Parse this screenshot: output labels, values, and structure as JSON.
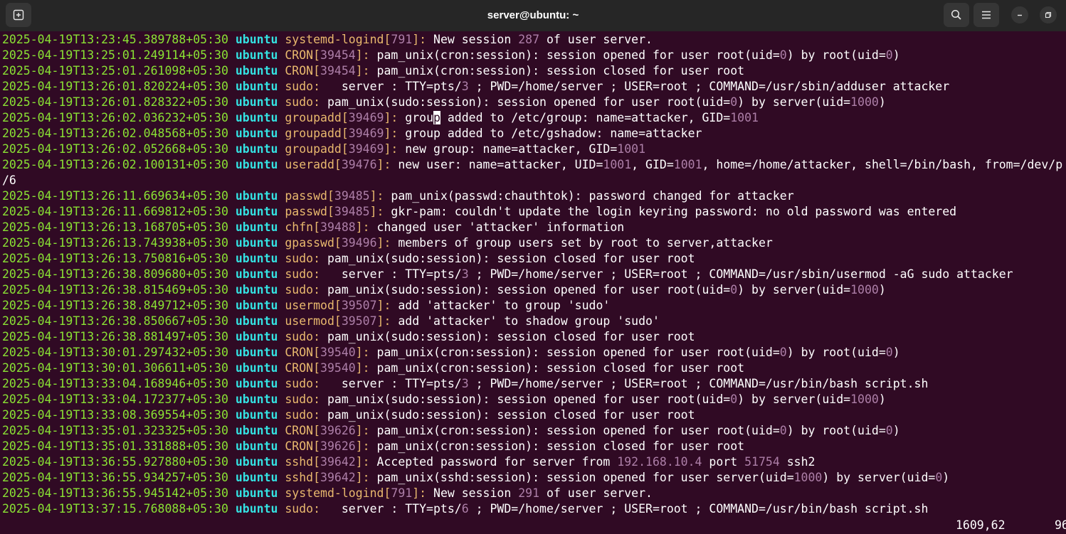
{
  "window": {
    "title": "server@ubuntu: ~",
    "new_tab_icon": "new-tab-icon",
    "search_icon": "search-icon",
    "menu_icon": "hamburger-menu-icon",
    "minimize_icon": "minimize-icon",
    "restore_icon": "restore-icon"
  },
  "colors": {
    "background": "#300a24",
    "timestamp": "#8ae234",
    "host": "#34e2e2",
    "process": "#e9b96e",
    "number": "#ad7fa8",
    "text": "#ffffff"
  },
  "log_lines": [
    {
      "ts": "2025-04-19T13:23:45.389788+05:30",
      "host": "ubuntu",
      "parts": [
        [
          "p",
          "systemd-logind["
        ],
        [
          "n",
          "791"
        ],
        [
          "p",
          "]:"
        ],
        [
          "t",
          " New session "
        ],
        [
          "n",
          "287"
        ],
        [
          "t",
          " of user server."
        ]
      ]
    },
    {
      "ts": "2025-04-19T13:25:01.249114+05:30",
      "host": "ubuntu",
      "parts": [
        [
          "p",
          "CRON["
        ],
        [
          "n",
          "39454"
        ],
        [
          "p",
          "]:"
        ],
        [
          "t",
          " pam_unix(cron:session): session opened for user root(uid="
        ],
        [
          "n",
          "0"
        ],
        [
          "t",
          ") by root(uid="
        ],
        [
          "n",
          "0"
        ],
        [
          "t",
          ")"
        ]
      ]
    },
    {
      "ts": "2025-04-19T13:25:01.261098+05:30",
      "host": "ubuntu",
      "parts": [
        [
          "p",
          "CRON["
        ],
        [
          "n",
          "39454"
        ],
        [
          "p",
          "]:"
        ],
        [
          "t",
          " pam_unix(cron:session): session closed for user root"
        ]
      ]
    },
    {
      "ts": "2025-04-19T13:26:01.820224+05:30",
      "host": "ubuntu",
      "parts": [
        [
          "p",
          "sudo:"
        ],
        [
          "t",
          "   server : TTY=pts/"
        ],
        [
          "n",
          "3"
        ],
        [
          "t",
          " ; PWD=/home/server ; USER=root ; COMMAND=/usr/sbin/adduser attacker"
        ]
      ]
    },
    {
      "ts": "2025-04-19T13:26:01.828322+05:30",
      "host": "ubuntu",
      "parts": [
        [
          "p",
          "sudo:"
        ],
        [
          "t",
          " pam_unix(sudo:session): session opened for user root(uid="
        ],
        [
          "n",
          "0"
        ],
        [
          "t",
          ") by server(uid="
        ],
        [
          "n",
          "1000"
        ],
        [
          "t",
          ")"
        ]
      ]
    },
    {
      "ts": "2025-04-19T13:26:02.036232+05:30",
      "host": "ubuntu",
      "parts": [
        [
          "p",
          "groupadd["
        ],
        [
          "n",
          "39469"
        ],
        [
          "p",
          "]:"
        ],
        [
          "t",
          " grou"
        ],
        [
          "c",
          "p"
        ],
        [
          "t",
          " added to /etc/group: name=attacker, GID="
        ],
        [
          "n",
          "1001"
        ]
      ]
    },
    {
      "ts": "2025-04-19T13:26:02.048568+05:30",
      "host": "ubuntu",
      "parts": [
        [
          "p",
          "groupadd["
        ],
        [
          "n",
          "39469"
        ],
        [
          "p",
          "]:"
        ],
        [
          "t",
          " group added to /etc/gshadow: name=attacker"
        ]
      ]
    },
    {
      "ts": "2025-04-19T13:26:02.052668+05:30",
      "host": "ubuntu",
      "parts": [
        [
          "p",
          "groupadd["
        ],
        [
          "n",
          "39469"
        ],
        [
          "p",
          "]:"
        ],
        [
          "t",
          " new group: name=attacker, GID="
        ],
        [
          "n",
          "1001"
        ]
      ]
    },
    {
      "ts": "2025-04-19T13:26:02.100131+05:30",
      "host": "ubuntu",
      "parts": [
        [
          "p",
          "useradd["
        ],
        [
          "n",
          "39476"
        ],
        [
          "p",
          "]:"
        ],
        [
          "t",
          " new user: name=attacker, UID="
        ],
        [
          "n",
          "1001"
        ],
        [
          "t",
          ", GID="
        ],
        [
          "n",
          "1001"
        ],
        [
          "t",
          ", home=/home/attacker, shell=/bin/bash, from=/dev/p"
        ]
      ]
    },
    {
      "ts": "",
      "host": "",
      "parts": [
        [
          "t",
          "/6"
        ]
      ]
    },
    {
      "ts": "2025-04-19T13:26:11.669634+05:30",
      "host": "ubuntu",
      "parts": [
        [
          "p",
          "passwd["
        ],
        [
          "n",
          "39485"
        ],
        [
          "p",
          "]:"
        ],
        [
          "t",
          " pam_unix(passwd:chauthtok): password changed for attacker"
        ]
      ]
    },
    {
      "ts": "2025-04-19T13:26:11.669812+05:30",
      "host": "ubuntu",
      "parts": [
        [
          "p",
          "passwd["
        ],
        [
          "n",
          "39485"
        ],
        [
          "p",
          "]:"
        ],
        [
          "t",
          " gkr-pam: couldn't update the login keyring password: no old password was entered"
        ]
      ]
    },
    {
      "ts": "2025-04-19T13:26:13.168705+05:30",
      "host": "ubuntu",
      "parts": [
        [
          "p",
          "chfn["
        ],
        [
          "n",
          "39488"
        ],
        [
          "p",
          "]:"
        ],
        [
          "t",
          " changed user 'attacker' information"
        ]
      ]
    },
    {
      "ts": "2025-04-19T13:26:13.743938+05:30",
      "host": "ubuntu",
      "parts": [
        [
          "p",
          "gpasswd["
        ],
        [
          "n",
          "39496"
        ],
        [
          "p",
          "]:"
        ],
        [
          "t",
          " members of group users set by root to server,attacker"
        ]
      ]
    },
    {
      "ts": "2025-04-19T13:26:13.750816+05:30",
      "host": "ubuntu",
      "parts": [
        [
          "p",
          "sudo:"
        ],
        [
          "t",
          " pam_unix(sudo:session): session closed for user root"
        ]
      ]
    },
    {
      "ts": "2025-04-19T13:26:38.809680+05:30",
      "host": "ubuntu",
      "parts": [
        [
          "p",
          "sudo:"
        ],
        [
          "t",
          "   server : TTY=pts/"
        ],
        [
          "n",
          "3"
        ],
        [
          "t",
          " ; PWD=/home/server ; USER=root ; COMMAND=/usr/sbin/usermod -aG sudo attacker"
        ]
      ]
    },
    {
      "ts": "2025-04-19T13:26:38.815469+05:30",
      "host": "ubuntu",
      "parts": [
        [
          "p",
          "sudo:"
        ],
        [
          "t",
          " pam_unix(sudo:session): session opened for user root(uid="
        ],
        [
          "n",
          "0"
        ],
        [
          "t",
          ") by server(uid="
        ],
        [
          "n",
          "1000"
        ],
        [
          "t",
          ")"
        ]
      ]
    },
    {
      "ts": "2025-04-19T13:26:38.849712+05:30",
      "host": "ubuntu",
      "parts": [
        [
          "p",
          "usermod["
        ],
        [
          "n",
          "39507"
        ],
        [
          "p",
          "]:"
        ],
        [
          "t",
          " add 'attacker' to group 'sudo'"
        ]
      ]
    },
    {
      "ts": "2025-04-19T13:26:38.850667+05:30",
      "host": "ubuntu",
      "parts": [
        [
          "p",
          "usermod["
        ],
        [
          "n",
          "39507"
        ],
        [
          "p",
          "]:"
        ],
        [
          "t",
          " add 'attacker' to shadow group 'sudo'"
        ]
      ]
    },
    {
      "ts": "2025-04-19T13:26:38.881497+05:30",
      "host": "ubuntu",
      "parts": [
        [
          "p",
          "sudo:"
        ],
        [
          "t",
          " pam_unix(sudo:session): session closed for user root"
        ]
      ]
    },
    {
      "ts": "2025-04-19T13:30:01.297432+05:30",
      "host": "ubuntu",
      "parts": [
        [
          "p",
          "CRON["
        ],
        [
          "n",
          "39540"
        ],
        [
          "p",
          "]:"
        ],
        [
          "t",
          " pam_unix(cron:session): session opened for user root(uid="
        ],
        [
          "n",
          "0"
        ],
        [
          "t",
          ") by root(uid="
        ],
        [
          "n",
          "0"
        ],
        [
          "t",
          ")"
        ]
      ]
    },
    {
      "ts": "2025-04-19T13:30:01.306611+05:30",
      "host": "ubuntu",
      "parts": [
        [
          "p",
          "CRON["
        ],
        [
          "n",
          "39540"
        ],
        [
          "p",
          "]:"
        ],
        [
          "t",
          " pam_unix(cron:session): session closed for user root"
        ]
      ]
    },
    {
      "ts": "2025-04-19T13:33:04.168946+05:30",
      "host": "ubuntu",
      "parts": [
        [
          "p",
          "sudo:"
        ],
        [
          "t",
          "   server : TTY=pts/"
        ],
        [
          "n",
          "3"
        ],
        [
          "t",
          " ; PWD=/home/server ; USER=root ; COMMAND=/usr/bin/bash script.sh"
        ]
      ]
    },
    {
      "ts": "2025-04-19T13:33:04.172377+05:30",
      "host": "ubuntu",
      "parts": [
        [
          "p",
          "sudo:"
        ],
        [
          "t",
          " pam_unix(sudo:session): session opened for user root(uid="
        ],
        [
          "n",
          "0"
        ],
        [
          "t",
          ") by server(uid="
        ],
        [
          "n",
          "1000"
        ],
        [
          "t",
          ")"
        ]
      ]
    },
    {
      "ts": "2025-04-19T13:33:08.369554+05:30",
      "host": "ubuntu",
      "parts": [
        [
          "p",
          "sudo:"
        ],
        [
          "t",
          " pam_unix(sudo:session): session closed for user root"
        ]
      ]
    },
    {
      "ts": "2025-04-19T13:35:01.323325+05:30",
      "host": "ubuntu",
      "parts": [
        [
          "p",
          "CRON["
        ],
        [
          "n",
          "39626"
        ],
        [
          "p",
          "]:"
        ],
        [
          "t",
          " pam_unix(cron:session): session opened for user root(uid="
        ],
        [
          "n",
          "0"
        ],
        [
          "t",
          ") by root(uid="
        ],
        [
          "n",
          "0"
        ],
        [
          "t",
          ")"
        ]
      ]
    },
    {
      "ts": "2025-04-19T13:35:01.331888+05:30",
      "host": "ubuntu",
      "parts": [
        [
          "p",
          "CRON["
        ],
        [
          "n",
          "39626"
        ],
        [
          "p",
          "]:"
        ],
        [
          "t",
          " pam_unix(cron:session): session closed for user root"
        ]
      ]
    },
    {
      "ts": "2025-04-19T13:36:55.927880+05:30",
      "host": "ubuntu",
      "parts": [
        [
          "p",
          "sshd["
        ],
        [
          "n",
          "39642"
        ],
        [
          "p",
          "]:"
        ],
        [
          "t",
          " Accepted password for server from "
        ],
        [
          "n",
          "192.168.10.4"
        ],
        [
          "t",
          " port "
        ],
        [
          "n",
          "51754"
        ],
        [
          "t",
          " ssh2"
        ]
      ]
    },
    {
      "ts": "2025-04-19T13:36:55.934257+05:30",
      "host": "ubuntu",
      "parts": [
        [
          "p",
          "sshd["
        ],
        [
          "n",
          "39642"
        ],
        [
          "p",
          "]:"
        ],
        [
          "t",
          " pam_unix(sshd:session): session opened for user server(uid="
        ],
        [
          "n",
          "1000"
        ],
        [
          "t",
          ") by server(uid="
        ],
        [
          "n",
          "0"
        ],
        [
          "t",
          ")"
        ]
      ]
    },
    {
      "ts": "2025-04-19T13:36:55.945142+05:30",
      "host": "ubuntu",
      "parts": [
        [
          "p",
          "systemd-logind["
        ],
        [
          "n",
          "791"
        ],
        [
          "p",
          "]:"
        ],
        [
          "t",
          " New session "
        ],
        [
          "n",
          "291"
        ],
        [
          "t",
          " of user server."
        ]
      ]
    },
    {
      "ts": "2025-04-19T13:37:15.768088+05:30",
      "host": "ubuntu",
      "parts": [
        [
          "p",
          "sudo:"
        ],
        [
          "t",
          "   server : TTY=pts/"
        ],
        [
          "n",
          "6"
        ],
        [
          "t",
          " ; PWD=/home/server ; USER=root ; COMMAND=/usr/bin/bash script.sh"
        ]
      ]
    }
  ],
  "status": {
    "position": "1609,62",
    "percent": "96"
  }
}
